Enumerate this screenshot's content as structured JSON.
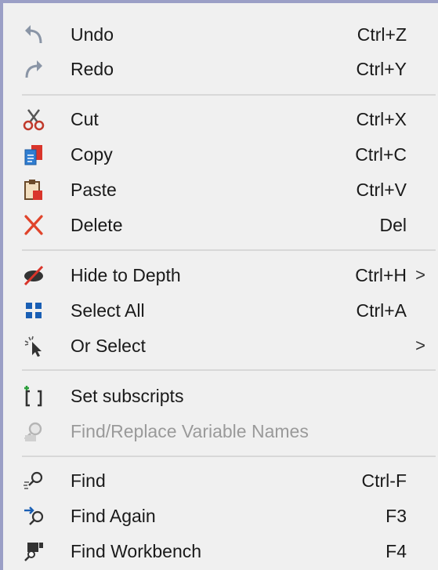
{
  "menu": {
    "undo": {
      "label": "Undo",
      "shortcut": "Ctrl+Z",
      "icon": "undo-icon"
    },
    "redo": {
      "label": "Redo",
      "shortcut": "Ctrl+Y",
      "icon": "redo-icon"
    },
    "cut": {
      "label": "Cut",
      "shortcut": "Ctrl+X",
      "icon": "scissors-icon"
    },
    "copy": {
      "label": "Copy",
      "shortcut": "Ctrl+C",
      "icon": "copy-icon"
    },
    "paste": {
      "label": "Paste",
      "shortcut": "Ctrl+V",
      "icon": "paste-icon"
    },
    "delete": {
      "label": "Delete",
      "shortcut": "Del",
      "icon": "delete-x-icon"
    },
    "hide_to_depth": {
      "label": "Hide to Depth",
      "shortcut": "Ctrl+H",
      "submenu": ">",
      "icon": "hide-eye-icon"
    },
    "select_all": {
      "label": "Select All",
      "shortcut": "Ctrl+A",
      "icon": "select-all-grid-icon"
    },
    "or_select": {
      "label": "Or Select",
      "submenu": ">",
      "icon": "cursor-select-icon"
    },
    "set_subscripts": {
      "label": "Set subscripts",
      "icon": "subscripts-icon"
    },
    "find_replace": {
      "label": "Find/Replace Variable Names",
      "icon": "find-replace-icon",
      "disabled": true
    },
    "find": {
      "label": "Find",
      "shortcut": "Ctrl-F",
      "icon": "find-icon"
    },
    "find_again": {
      "label": "Find Again",
      "shortcut": "F3",
      "icon": "find-again-icon"
    },
    "find_workbench": {
      "label": "Find Workbench",
      "shortcut": "F4",
      "icon": "find-workbench-icon"
    }
  },
  "colors": {
    "accent": "#1a5fb4",
    "delete_red": "#e0442b",
    "border": "#9b9fc6"
  }
}
